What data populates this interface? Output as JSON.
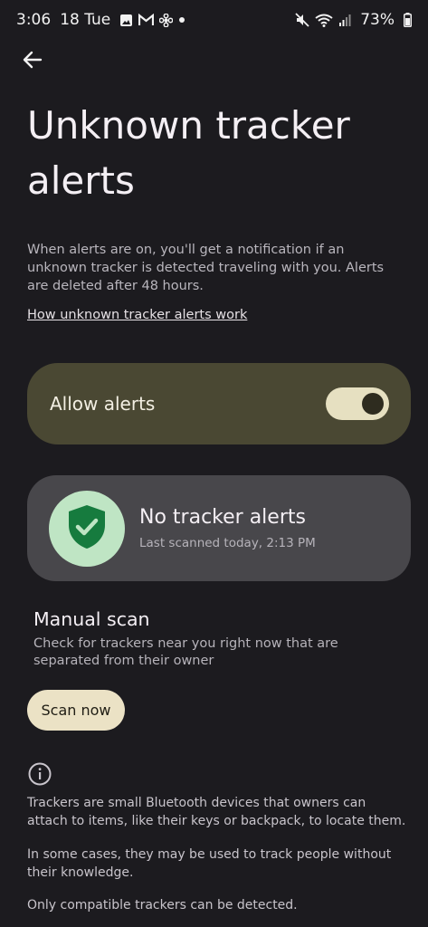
{
  "status_bar": {
    "time": "3:06",
    "date": "18 Tue",
    "battery": "73%"
  },
  "header": {
    "title": "Unknown tracker alerts"
  },
  "description": "When alerts are on, you'll get a notification if an unknown tracker is detected traveling with you. Alerts are deleted after 48 hours.",
  "help_link": "How unknown tracker alerts work",
  "allow_alerts": {
    "label": "Allow alerts",
    "enabled": true
  },
  "status": {
    "title": "No tracker alerts",
    "subtitle": "Last scanned today, 2:13 PM",
    "icon": "shield-check-icon"
  },
  "manual_scan": {
    "title": "Manual scan",
    "description": "Check for trackers near you right now that are separated from their owner",
    "button_label": "Scan now"
  },
  "info": {
    "icon": "info-icon",
    "paragraphs": [
      "Trackers are small Bluetooth devices that owners can attach to items, like their keys or backpack, to locate them.",
      "In some cases, they may be used to track people without their knowledge.",
      "Only compatible trackers can be detected."
    ]
  },
  "colors": {
    "background": "#1c1b1f",
    "allow_card": "#4a4833",
    "status_card": "#48474b",
    "shield_bg": "#bfe5c4",
    "shield": "#167b3e",
    "scan_button": "#ebe2c5"
  }
}
